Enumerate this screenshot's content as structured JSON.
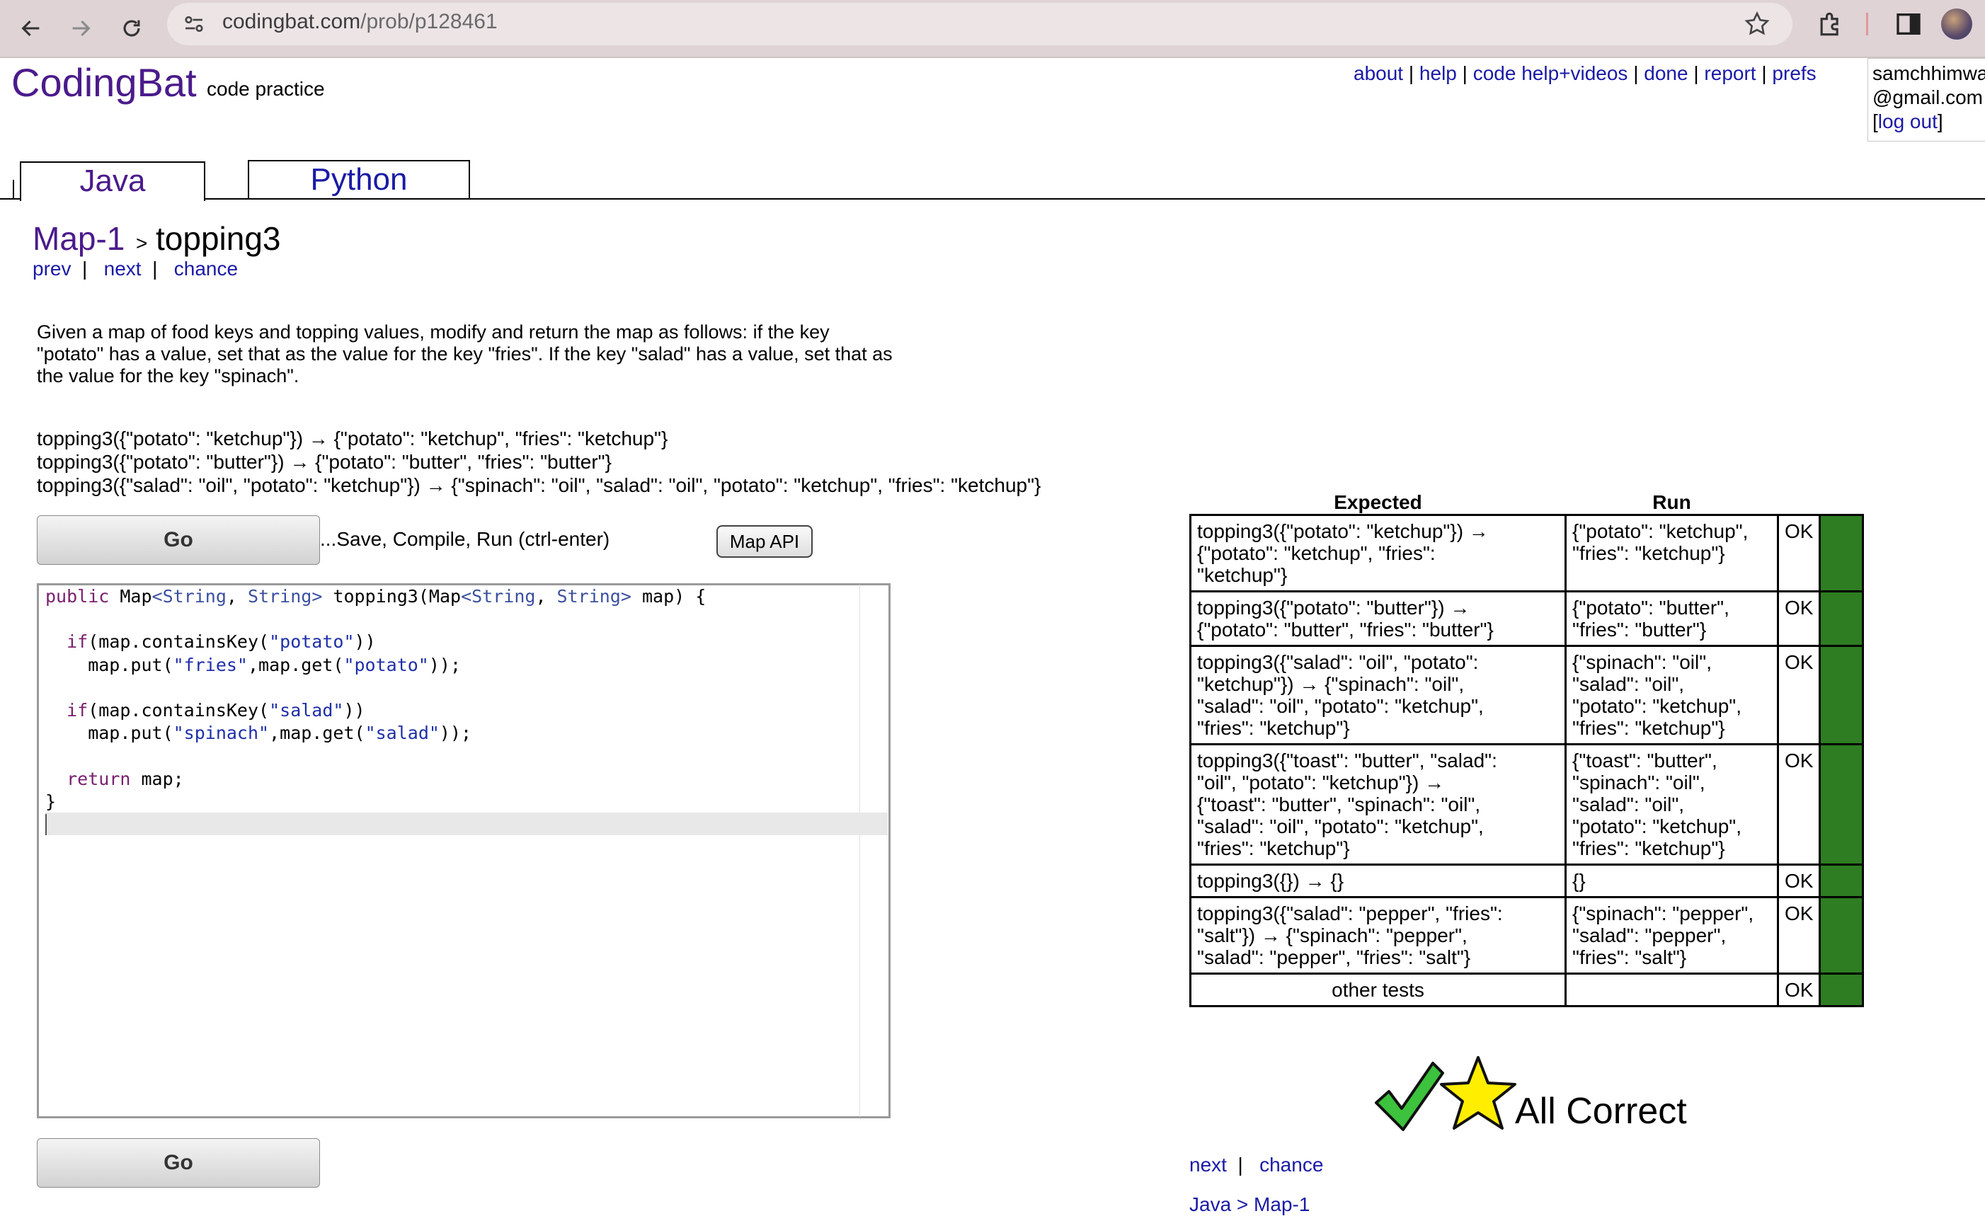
{
  "browser": {
    "url_host": "codingbat.com",
    "url_path": "/prob/p128461"
  },
  "header": {
    "logo": "CodingBat",
    "tagline": "code practice",
    "nav": [
      "about",
      "help",
      "code help+videos",
      "done",
      "report",
      "prefs"
    ],
    "user_line1": "samchhimwa",
    "user_line2": "@gmail.com",
    "logout": "log out"
  },
  "tabs": {
    "java": "Java",
    "python": "Python"
  },
  "breadcrumb": {
    "section": "Map-1",
    "separator": ">",
    "title": "topping3"
  },
  "problem_nav": {
    "prev": "prev",
    "next": "next",
    "chance": "chance"
  },
  "description": "Given a map of food keys and topping values, modify and return the map as follows: if the key \"potato\" has a value, set that as the value for the key \"fries\". If the key \"salad\" has a value, set that as the value for the key \"spinach\".",
  "examples": [
    "topping3({\"potato\": \"ketchup\"}) → {\"potato\": \"ketchup\", \"fries\": \"ketchup\"}",
    "topping3({\"potato\": \"butter\"}) → {\"potato\": \"butter\", \"fries\": \"butter\"}",
    "topping3({\"salad\": \"oil\", \"potato\": \"ketchup\"}) → {\"spinach\": \"oil\", \"salad\": \"oil\", \"potato\": \"ketchup\", \"fries\": \"ketchup\"}"
  ],
  "controls": {
    "go": "Go",
    "save_text": "...Save, Compile, Run (ctrl-enter)",
    "map_api": "Map API"
  },
  "code_lines": [
    "public Map<String, String> topping3(Map<String, String> map) {",
    "",
    "  if(map.containsKey(\"potato\"))",
    "    map.put(\"fries\",map.get(\"potato\"));",
    "",
    "  if(map.containsKey(\"salad\"))",
    "    map.put(\"spinach\",map.get(\"salad\"));",
    "",
    "  return map;",
    "}"
  ],
  "results": {
    "header_expected": "Expected",
    "header_run": "Run",
    "rows": [
      {
        "expected": [
          "topping3({\"potato\": \"ketchup\"}) →",
          "{\"potato\": \"ketchup\", \"fries\":",
          "\"ketchup\"}"
        ],
        "run": [
          "{\"potato\": \"ketchup\",",
          "\"fries\": \"ketchup\"}"
        ],
        "status": "OK"
      },
      {
        "expected": [
          "topping3({\"potato\": \"butter\"}) →",
          "{\"potato\": \"butter\", \"fries\": \"butter\"}"
        ],
        "run": [
          "{\"potato\": \"butter\",",
          "\"fries\": \"butter\"}"
        ],
        "status": "OK"
      },
      {
        "expected": [
          "topping3({\"salad\": \"oil\", \"potato\":",
          "\"ketchup\"}) → {\"spinach\": \"oil\",",
          "\"salad\": \"oil\", \"potato\": \"ketchup\",",
          "\"fries\": \"ketchup\"}"
        ],
        "run": [
          "{\"spinach\": \"oil\",",
          "\"salad\": \"oil\",",
          "\"potato\": \"ketchup\",",
          "\"fries\": \"ketchup\"}"
        ],
        "status": "OK"
      },
      {
        "expected": [
          "topping3({\"toast\": \"butter\", \"salad\":",
          "\"oil\", \"potato\": \"ketchup\"}) →",
          "{\"toast\": \"butter\", \"spinach\": \"oil\",",
          "\"salad\": \"oil\", \"potato\": \"ketchup\",",
          "\"fries\": \"ketchup\"}"
        ],
        "run": [
          "{\"toast\": \"butter\",",
          "\"spinach\": \"oil\",",
          "\"salad\": \"oil\",",
          "\"potato\": \"ketchup\",",
          "\"fries\": \"ketchup\"}"
        ],
        "status": "OK"
      },
      {
        "expected": [
          "topping3({}) → {}"
        ],
        "run": [
          "{}"
        ],
        "status": "OK"
      },
      {
        "expected": [
          "topping3({\"salad\": \"pepper\", \"fries\":",
          "\"salt\"}) → {\"spinach\": \"pepper\",",
          "\"salad\": \"pepper\", \"fries\": \"salt\"}"
        ],
        "run": [
          "{\"spinach\": \"pepper\",",
          "\"salad\": \"pepper\",",
          "\"fries\": \"salt\"}"
        ],
        "status": "OK"
      }
    ],
    "other_tests": "other tests",
    "other_status": "OK",
    "pass_color": "#2e7d22"
  },
  "result_banner": {
    "text": "All Correct",
    "check_icon": "green-checkmark-icon",
    "star_icon": "yellow-star-icon"
  },
  "bottom_nav": {
    "next": "next",
    "chance": "chance",
    "crumb": "Java > Map-1"
  }
}
